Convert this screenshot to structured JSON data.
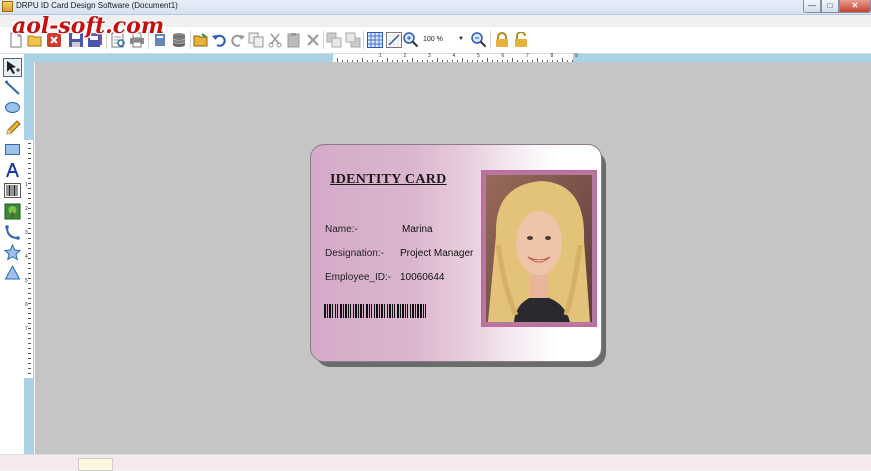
{
  "window": {
    "title": "DRPU ID Card Design Software  (Document1)",
    "minimize_glyph": "—",
    "maximize_glyph": "□",
    "close_glyph": "✕"
  },
  "watermark": "aol-soft.com",
  "toolbar": {
    "buttons": [
      "new-icon",
      "open-icon",
      "close-icon",
      "save-icon",
      "save-all-icon",
      "print-preview-icon",
      "print-icon",
      "import-icon",
      "database-icon",
      "folder-open-icon",
      "undo-icon",
      "redo-icon",
      "copy-icon",
      "cut-icon",
      "paste-icon",
      "delete-icon",
      "bring-front-icon",
      "send-back-icon",
      "grid-icon",
      "snap-grid-icon",
      "zoom-in-icon",
      "zoom-out-icon",
      "lock-icon",
      "unlock-icon"
    ],
    "zoom_value": "100 %"
  },
  "ruler": {
    "top_numbers": [
      "1",
      "2",
      "3",
      "4",
      "5",
      "6",
      "7",
      "8",
      "9"
    ],
    "left_numbers": [
      "1",
      "2",
      "3",
      "4",
      "5",
      "6",
      "7"
    ]
  },
  "palette": {
    "tools": [
      "pointer-tool-icon",
      "line-tool-icon",
      "ellipse-tool-icon",
      "pencil-tool-icon",
      "rectangle-tool-icon",
      "text-tool-icon",
      "barcode-tool-icon",
      "image-tool-icon",
      "arc-tool-icon",
      "star-tool-icon",
      "triangle-tool-icon"
    ]
  },
  "card": {
    "title": "IDENTITY CARD",
    "fields": [
      {
        "label": "Name:-",
        "value": "Marina"
      },
      {
        "label": "Designation:-",
        "value": "Project Manager"
      },
      {
        "label": "Employee_ID:-",
        "value": "10060644"
      }
    ],
    "colors": {
      "background_start": "#d4aac8",
      "background_end": "#ffffff",
      "photo_border": "#c46aa0"
    }
  },
  "colors": {
    "canvas": "#c5c5c5",
    "ruler_strip": "#a9d2e6",
    "watermark": "#c41010"
  }
}
